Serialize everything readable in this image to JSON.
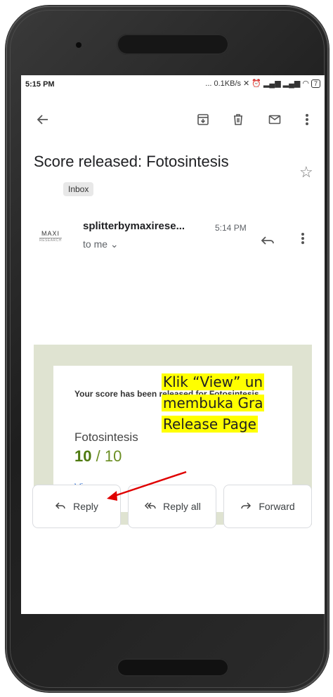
{
  "status": {
    "time": "5:15 PM",
    "network_speed": "... 0.1KB/s",
    "battery": "7"
  },
  "email": {
    "subject": "Score released: Fotosintesis",
    "label": "Inbox",
    "sender": "splitterbymaxirese...",
    "sender_time": "5:14 PM",
    "recipient": "to me",
    "avatar_text": "MAXI",
    "avatar_subtext": "RESEARCH"
  },
  "body": {
    "intro": "Your score has been released for Fotosintesis.",
    "assignment": "Fotosintesis",
    "score": "10",
    "score_total": "/ 10",
    "view_link": "View"
  },
  "annotation": {
    "line1": "Klik “View” un",
    "line2": "membuka Gra",
    "line3": "Release Page"
  },
  "actions": {
    "reply": "Reply",
    "reply_all": "Reply all",
    "forward": "Forward"
  },
  "colors": {
    "accent_link": "#2a6bd1",
    "score_green": "#4f7a10",
    "body_bg": "#dfe3d1",
    "annotation_highlight": "#ffff00",
    "arrow": "#e00000"
  }
}
